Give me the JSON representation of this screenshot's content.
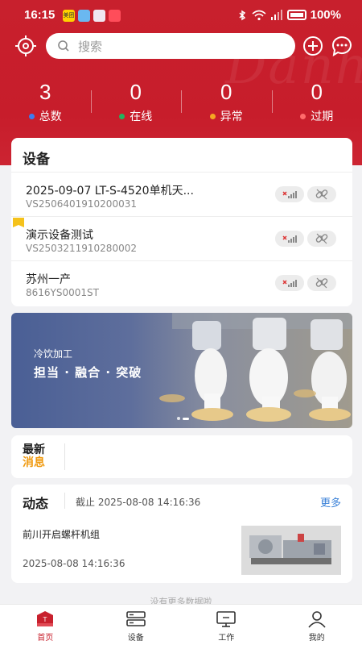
{
  "status": {
    "time": "16:15",
    "battery": "100%",
    "app_badges": [
      "美团",
      "",
      "",
      ""
    ]
  },
  "header": {
    "search_placeholder": "搜索",
    "watermark": "Danh"
  },
  "stats": [
    {
      "value": "3",
      "label": "总数",
      "dot_color": "#3b7cf0"
    },
    {
      "value": "0",
      "label": "在线",
      "dot_color": "#22b35e"
    },
    {
      "value": "0",
      "label": "异常",
      "dot_color": "#f5a623"
    },
    {
      "value": "0",
      "label": "过期",
      "dot_color": "#ff6b6b"
    }
  ],
  "devices": {
    "title": "设备",
    "items": [
      {
        "name": "2025-09-07 LT-S-4520单机天...",
        "code": "VS2506401910200031"
      },
      {
        "name": "演示设备测试",
        "code": "VS2503211910280002"
      },
      {
        "name": "苏州一产",
        "code": "8616YS0001ST"
      }
    ]
  },
  "banner": {
    "subtitle": "冷饮加工",
    "title": "担当 · 融合 · 突破"
  },
  "news": {
    "line1": "最新",
    "line2": "消息"
  },
  "activity": {
    "title": "动态",
    "cutoff": "截止 2025-08-08 14:16:36",
    "more": "更多",
    "item_title": "前川开启螺杆机组",
    "item_time": "2025-08-08 14:16:36"
  },
  "footer_text": "没有更多数据啦",
  "tabs": [
    {
      "label": "首页"
    },
    {
      "label": "设备"
    },
    {
      "label": "工作"
    },
    {
      "label": "我的"
    }
  ],
  "colors": {
    "brand_red": "#c8202d",
    "link_blue": "#3b82d8",
    "news_orange": "#f09a10"
  }
}
